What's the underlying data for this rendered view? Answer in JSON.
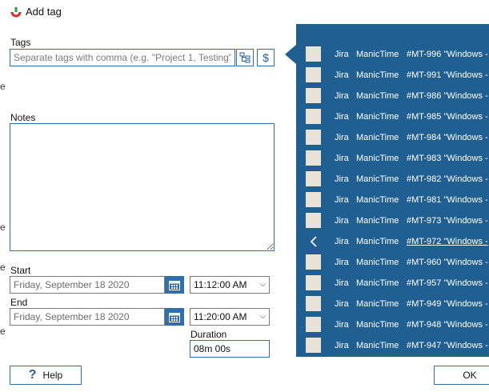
{
  "window": {
    "title": "Add tag"
  },
  "tags": {
    "label": "Tags",
    "placeholder": "Separate tags with comma (e.g. \"Project 1, Testing\")",
    "tag_picker_icon": "tag-tree-icon",
    "billable_icon": "dollar-icon",
    "billable_symbol": "$"
  },
  "notes": {
    "label": "Notes",
    "value": ""
  },
  "start": {
    "label": "Start",
    "date": "Friday, September 18 2020",
    "time": "11:12:00 AM"
  },
  "end": {
    "label": "End",
    "date": "Friday, September 18 2020",
    "time": "11:20:00 AM"
  },
  "duration": {
    "label": "Duration",
    "value": "08m 00s"
  },
  "buttons": {
    "help": "Help",
    "ok": "OK"
  },
  "left_edge": [
    "e",
    "e",
    "e",
    "e"
  ],
  "suggestions": [
    {
      "source": "Jira",
      "app": "ManicTime",
      "text": "#MT-996 \"Windows -"
    },
    {
      "source": "Jira",
      "app": "ManicTime",
      "text": "#MT-991 \"Windows -"
    },
    {
      "source": "Jira",
      "app": "ManicTime",
      "text": "#MT-986 \"Windows -"
    },
    {
      "source": "Jira",
      "app": "ManicTime",
      "text": "#MT-985 \"Windows -"
    },
    {
      "source": "Jira",
      "app": "ManicTime",
      "text": "#MT-984 \"Windows -"
    },
    {
      "source": "Jira",
      "app": "ManicTime",
      "text": "#MT-983 \"Windows -"
    },
    {
      "source": "Jira",
      "app": "ManicTime",
      "text": "#MT-982 \"Windows -"
    },
    {
      "source": "Jira",
      "app": "ManicTime",
      "text": "#MT-981 \"Windows -"
    },
    {
      "source": "Jira",
      "app": "ManicTime",
      "text": "#MT-973 \"Windows -"
    },
    {
      "source": "Jira",
      "app": "ManicTime",
      "text": "#MT-972 \"Windows -",
      "active": true
    },
    {
      "source": "Jira",
      "app": "ManicTime",
      "text": "#MT-960 \"Windows -"
    },
    {
      "source": "Jira",
      "app": "ManicTime",
      "text": "#MT-957 \"Windows -"
    },
    {
      "source": "Jira",
      "app": "ManicTime",
      "text": "#MT-949 \"Windows -"
    },
    {
      "source": "Jira",
      "app": "ManicTime",
      "text": "#MT-948 \"Windows -"
    },
    {
      "source": "Jira",
      "app": "ManicTime",
      "text": "#MT-947 \"Windows -"
    }
  ]
}
